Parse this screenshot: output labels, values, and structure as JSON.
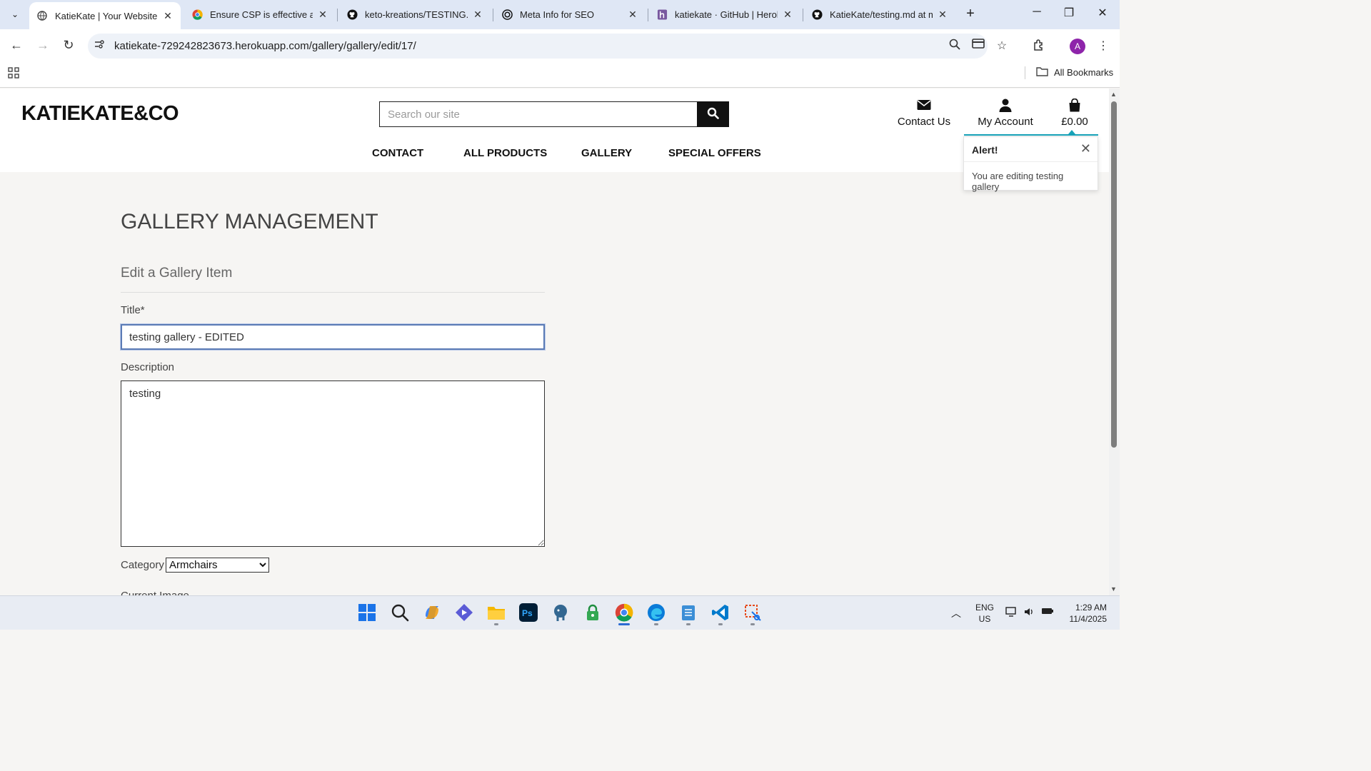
{
  "browser": {
    "tabs": [
      {
        "title": "KatieKate | Your Website",
        "favicon": "globe-icon",
        "active": true
      },
      {
        "title": "Ensure CSP is effective aga",
        "favicon": "chrome-icon",
        "active": false
      },
      {
        "title": "keto-kreations/TESTING.m",
        "favicon": "github-icon",
        "active": false
      },
      {
        "title": "Meta Info for SEO",
        "favicon": "openai-icon",
        "active": false
      },
      {
        "title": "katiekate · GitHub | Heroku",
        "favicon": "heroku-icon",
        "active": false
      },
      {
        "title": "KatieKate/testing.md at m",
        "favicon": "github-icon",
        "active": false
      }
    ],
    "url": "katiekate-729242823673.herokuapp.com/gallery/gallery/edit/17/",
    "profile_initial": "A",
    "bookmarks_label": "All Bookmarks"
  },
  "site": {
    "logo": "KATIEKATE&CO",
    "search_placeholder": "Search our site",
    "header_links": {
      "contact": "Contact Us",
      "account": "My Account",
      "basket": "£0.00"
    },
    "nav": [
      "CONTACT",
      "ALL PRODUCTS",
      "GALLERY",
      "SPECIAL OFFERS"
    ],
    "accent_color": "#17a2b8"
  },
  "alert": {
    "heading": "Alert!",
    "message": "You are editing testing gallery"
  },
  "main": {
    "page_title": "GALLERY MANAGEMENT",
    "subtitle": "Edit a Gallery Item",
    "title_label": "Title*",
    "title_value": "testing gallery - EDITED",
    "description_label": "Description",
    "description_value": "testing",
    "category_label": "Category",
    "category_value": "Armchairs",
    "next_label_partial": "Current Image"
  },
  "taskbar": {
    "lang_line1": "ENG",
    "lang_line2": "US",
    "time": "1:29 AM",
    "date": "11/4/2025"
  }
}
